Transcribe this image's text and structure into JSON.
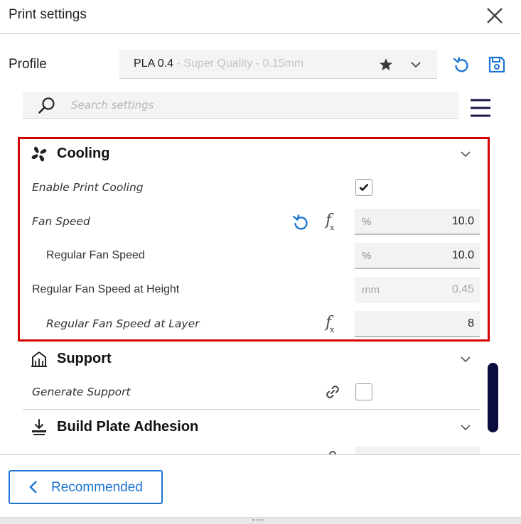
{
  "window": {
    "title": "Print settings"
  },
  "profile": {
    "label": "Profile",
    "material": "PLA 0.4",
    "quality": " - Super Quality - 0.15mm"
  },
  "search": {
    "placeholder": "Search settings"
  },
  "categories": {
    "cooling": {
      "title": "Cooling",
      "settings": [
        {
          "label": "Enable Print Cooling",
          "type": "checkbox",
          "checked": true
        },
        {
          "label": "Fan Speed",
          "unit": "%",
          "value": "10.0"
        },
        {
          "label": "Regular Fan Speed",
          "unit": "%",
          "value": "10.0"
        },
        {
          "label": "Regular Fan Speed at Height",
          "unit": "mm",
          "value": "0.45"
        },
        {
          "label": "Regular Fan Speed at Layer",
          "value": "8"
        }
      ]
    },
    "support": {
      "title": "Support",
      "settings": [
        {
          "label": "Generate Support",
          "type": "checkbox",
          "checked": false
        }
      ]
    },
    "adhesion": {
      "title": "Build Plate Adhesion"
    }
  },
  "footer": {
    "recommended_label": "Recommended"
  },
  "colors": {
    "accent": "#1b74d3",
    "highlight": "#d50000",
    "scrollbar": "#0b0b3d"
  },
  "icons": [
    "close-icon",
    "star-icon",
    "chevron-down-icon",
    "reset-icon",
    "save-icon",
    "search-icon",
    "hamburger-menu-icon",
    "fan-icon",
    "formula-icon",
    "support-icon",
    "link-icon",
    "adhesion-icon",
    "chevron-left-icon"
  ]
}
